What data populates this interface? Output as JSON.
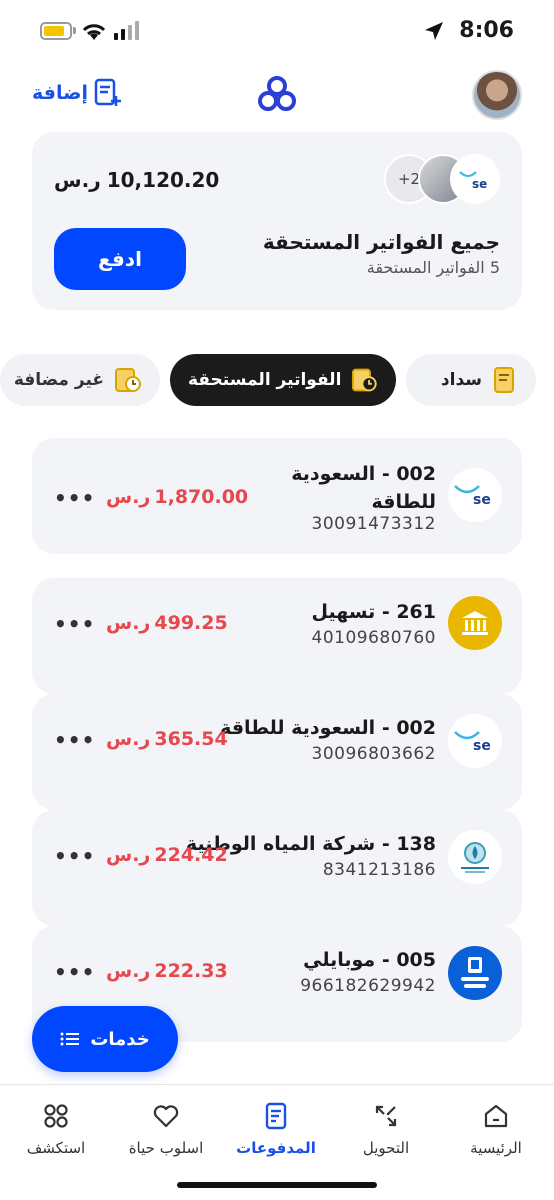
{
  "status_bar": {
    "time": "8:06"
  },
  "header": {
    "add_label": "إضافة"
  },
  "summary": {
    "amount": "10,120.20",
    "currency": "ر.س",
    "extra_count": "+2",
    "title": "جميع الفواتير المستحقة",
    "subtitle": "5 الفواتير المستحقة",
    "pay_label": "ادفع"
  },
  "tabs": [
    {
      "label": "سداد"
    },
    {
      "label": "الفواتير المستحقة"
    },
    {
      "label": "غير مضافة"
    }
  ],
  "bills": [
    {
      "name_line1": "002 -  السعودية",
      "name_line2": "للطاقة",
      "account": "30091473312",
      "amount": "1,870.00",
      "logo": "se-logo"
    },
    {
      "name_line1": "261 - تسهيل",
      "name_line2": "",
      "account": "40109680760",
      "amount": "499.25",
      "logo": "bank-icon"
    },
    {
      "name_line1": "002 -  السعودية للطاقة",
      "name_line2": "",
      "account": "30096803662",
      "amount": "365.54",
      "logo": "se-logo"
    },
    {
      "name_line1": "138 - شركة المياه الوطنية",
      "name_line2": "",
      "account": "8341213186",
      "amount": "224.42",
      "logo": "nwc-logo"
    },
    {
      "name_line1": "005 - موبايلي",
      "name_line2": "",
      "account": "966182629942",
      "amount": "222.33",
      "logo": "mobily-logo"
    }
  ],
  "more_label": "•••",
  "services_label": "خدمات",
  "nav": [
    {
      "label": "الرئيسية",
      "icon": "home-icon"
    },
    {
      "label": "التحويل",
      "icon": "transfer-icon"
    },
    {
      "label": "المدفوعات",
      "icon": "payments-icon",
      "active": true
    },
    {
      "label": "اسلوب حياة",
      "icon": "heart-icon"
    },
    {
      "label": "استكشف",
      "icon": "grid-icon"
    }
  ],
  "colors": {
    "primary": "#0047ff",
    "amount_red": "#e5484d",
    "card_bg": "#f3f4f7"
  }
}
